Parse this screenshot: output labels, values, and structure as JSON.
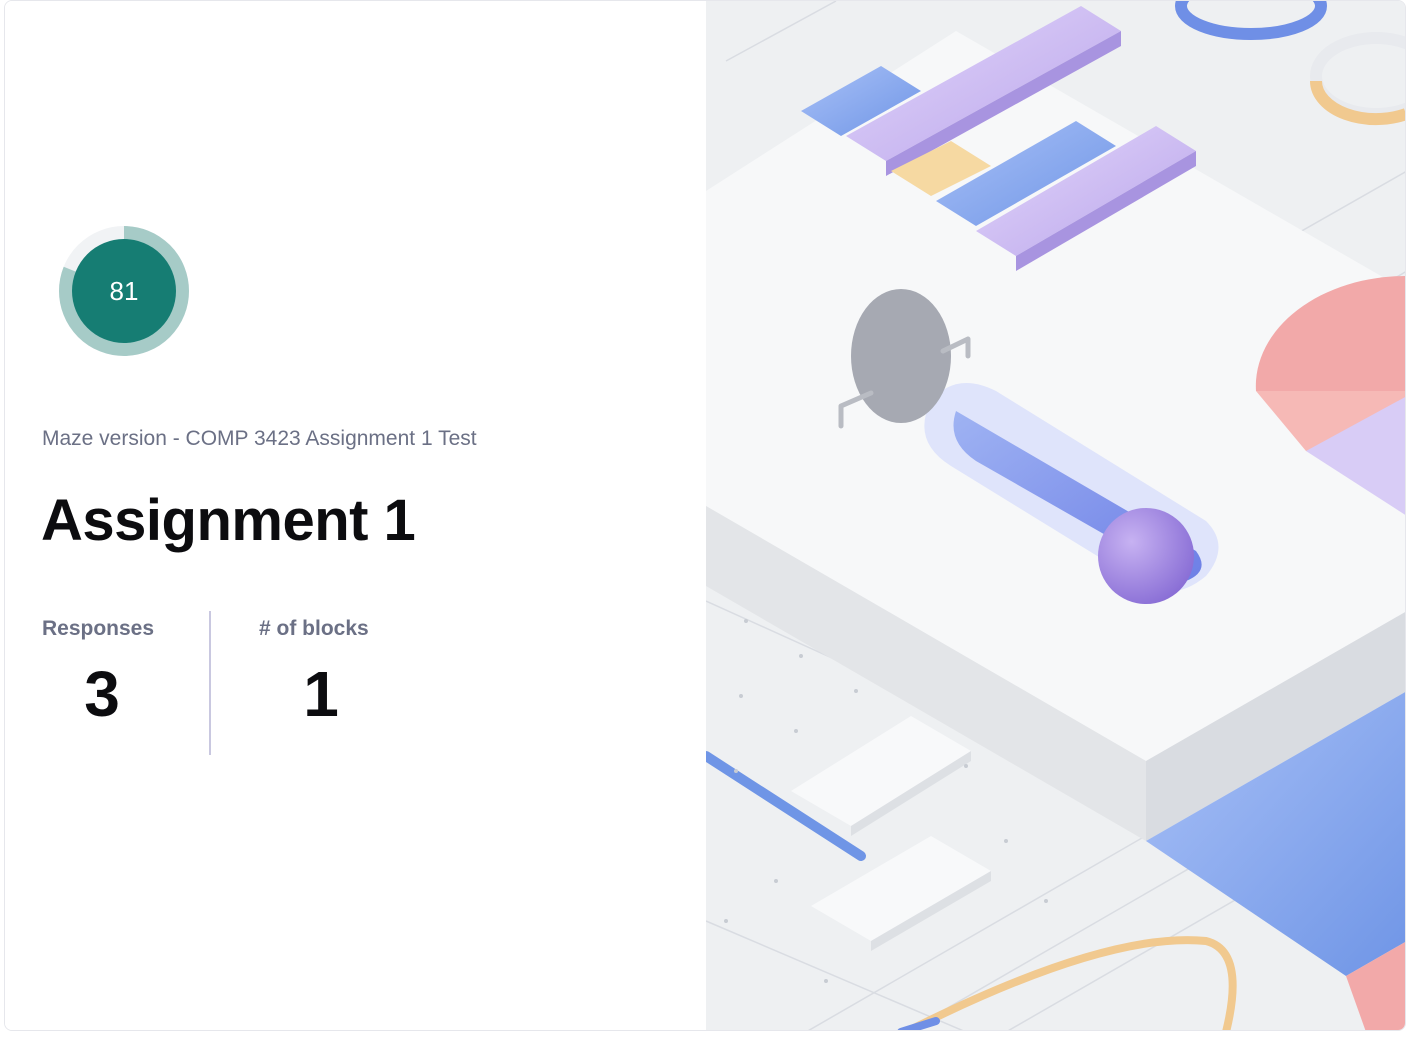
{
  "score": {
    "value": "81",
    "fraction": 0.81,
    "ring_color": "#a6cbc7",
    "fill_color": "#167d73"
  },
  "maze": {
    "subtitle": "Maze version - COMP 3423 Assignment 1 Test",
    "title": "Assignment 1"
  },
  "stats": {
    "responses_label": "Responses",
    "responses_value": "3",
    "blocks_label": "# of blocks",
    "blocks_value": "1"
  },
  "colors": {
    "label_gray": "#6b7085",
    "divider": "#c9c8e0",
    "accent_blue": "#6f95e6",
    "accent_purple": "#c7b6f0",
    "accent_pink": "#f2a9a9",
    "accent_yellow": "#f6d9a2"
  }
}
